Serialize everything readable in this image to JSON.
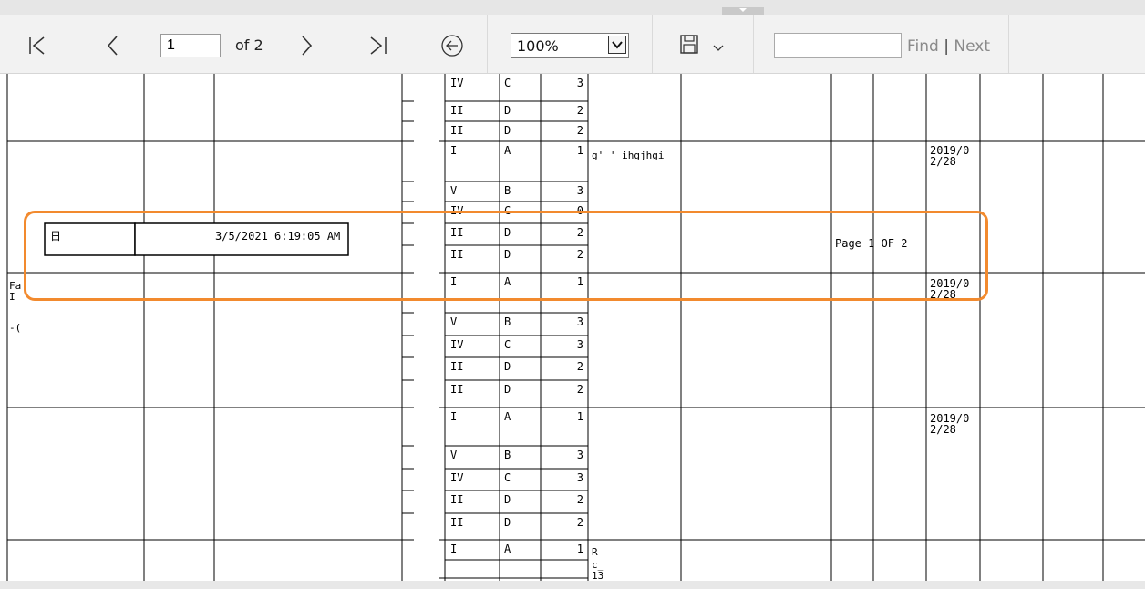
{
  "toolbar": {
    "page_current": "1",
    "page_of": "of 2",
    "zoom_value": "100%",
    "find_placeholder": "",
    "find_label": "Find",
    "find_separator": "|",
    "next_label": "Next"
  },
  "report": {
    "timestamp": "3/5/2021 6:19:05 AM",
    "page_label": "Page 1 OF 2",
    "date_1": "2019/0\n2/28",
    "date_1a": "2019/0",
    "date_1b": "2/28",
    "row_note_1": "g'  ' ihgjhgi",
    "row_note_2": "R",
    "row_note_2b": "c_",
    "row_note_2c": "13",
    "grade_rows": [
      {
        "roman": "IV",
        "letter": "C",
        "num": "3"
      },
      {
        "roman": "II",
        "letter": "D",
        "num": "2"
      },
      {
        "roman": "II",
        "letter": "D",
        "num": "2"
      },
      {
        "roman": "I",
        "letter": "A",
        "num": "1"
      },
      {
        "roman": "V",
        "letter": "B",
        "num": "3"
      },
      {
        "roman": "IV",
        "letter": "C",
        "num": "0"
      },
      {
        "roman": "II",
        "letter": "D",
        "num": "2"
      },
      {
        "roman": "II",
        "letter": "D",
        "num": "2"
      },
      {
        "roman": "I",
        "letter": "A",
        "num": "1"
      },
      {
        "roman": "V",
        "letter": "B",
        "num": "3"
      },
      {
        "roman": "IV",
        "letter": "C",
        "num": "3"
      },
      {
        "roman": "II",
        "letter": "D",
        "num": "2"
      },
      {
        "roman": "II",
        "letter": "D",
        "num": "2"
      },
      {
        "roman": "I",
        "letter": "A",
        "num": "1"
      },
      {
        "roman": "V",
        "letter": "B",
        "num": "3"
      },
      {
        "roman": "IV",
        "letter": "C",
        "num": "3"
      },
      {
        "roman": "II",
        "letter": "D",
        "num": "2"
      },
      {
        "roman": "II",
        "letter": "D",
        "num": "2"
      },
      {
        "roman": "I",
        "letter": "A",
        "num": "1"
      }
    ],
    "left_fragment_1": "Fa",
    "left_fragment_2": "I",
    "left_fragment_3": "-(",
    "box_label": "日"
  },
  "colors": {
    "highlight": "#f28a2e",
    "toolbar_bg": "#f2f2f2"
  }
}
